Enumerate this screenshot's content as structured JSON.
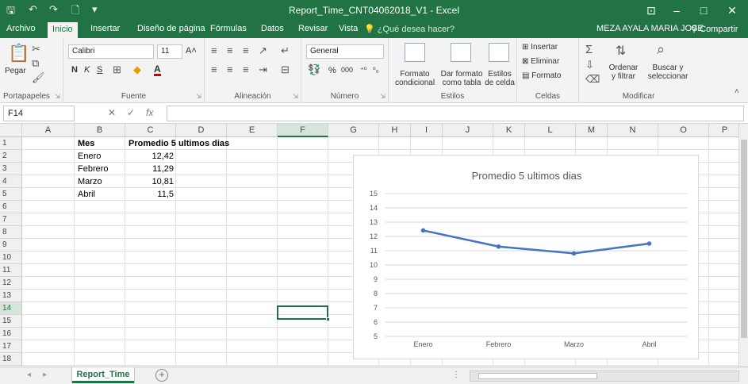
{
  "window": {
    "title": "Report_Time_CNT04062018_V1 - Excel",
    "minimize": "–",
    "maximize": "□",
    "close": "✕",
    "ribbon_display": "⊡"
  },
  "quick_access": {
    "save": "🖫",
    "undo": "↶",
    "redo": "↷",
    "new": "🗋",
    "customize": "▾"
  },
  "tabs": [
    "Archivo",
    "Inicio",
    "Insertar",
    "Diseño de página",
    "Fórmulas",
    "Datos",
    "Revisar",
    "Vista"
  ],
  "active_tab": "Inicio",
  "tell_me": "¿Qué desea hacer?",
  "user": "MEZA AYALA MARIA JOSE",
  "share": "Compartir",
  "ribbon": {
    "clipboard": {
      "label": "Portapapeles",
      "paste": "Pegar"
    },
    "font": {
      "label": "Fuente",
      "name": "Calibri",
      "size": "11",
      "bold": "N",
      "italic": "K",
      "underline": "S"
    },
    "alignment": {
      "label": "Alineación"
    },
    "number": {
      "label": "Número",
      "format": "General",
      "percent": "%",
      "thousands": "000"
    },
    "styles": {
      "label": "Estilos",
      "conditional": "Formato condicional",
      "as_table": "Dar formato como tabla",
      "cell_styles": "Estilos de celda"
    },
    "cells": {
      "label": "Celdas",
      "insert": "Insertar",
      "delete": "Eliminar",
      "format": "Formato"
    },
    "editing": {
      "label": "Modificar",
      "sort": "Ordenar y filtrar",
      "find": "Buscar y seleccionar"
    }
  },
  "formula_bar": {
    "name_box": "F14",
    "fx": "fx",
    "cancel": "✕",
    "enter": "✓",
    "value": ""
  },
  "columns": [
    "A",
    "B",
    "C",
    "D",
    "E",
    "F",
    "G",
    "H",
    "I",
    "J",
    "K",
    "L",
    "M",
    "N",
    "O",
    "P"
  ],
  "selected_column": "F",
  "rows": [
    "1",
    "2",
    "3",
    "4",
    "5",
    "6",
    "7",
    "8",
    "9",
    "10",
    "11",
    "12",
    "13",
    "14",
    "15",
    "16",
    "17",
    "18"
  ],
  "selected_row": "14",
  "cells": {
    "header_mes": "Mes",
    "header_promedio": "Promedio 5 ultimos dias",
    "data": [
      {
        "mes": "Enero",
        "valor": "12,42"
      },
      {
        "mes": "Febrero",
        "valor": "11,29"
      },
      {
        "mes": "Marzo",
        "valor": "10,81"
      },
      {
        "mes": "Abril",
        "valor": "11,5"
      }
    ]
  },
  "sheet_tabs": [
    "Report_Time"
  ],
  "add_sheet": "+",
  "chart_data": {
    "type": "line",
    "title": "Promedio 5 ultimos dias",
    "categories": [
      "Enero",
      "Febrero",
      "Marzo",
      "Abril"
    ],
    "values": [
      12.42,
      11.29,
      10.81,
      11.5
    ],
    "ylim": [
      5,
      15
    ],
    "yticks": [
      "5",
      "6",
      "7",
      "8",
      "9",
      "10",
      "11",
      "12",
      "13",
      "14",
      "15"
    ],
    "grid": true,
    "legend": "none",
    "color": "#4472C4"
  },
  "colors": {
    "excel_green": "#217346",
    "series": "#4472C4"
  }
}
